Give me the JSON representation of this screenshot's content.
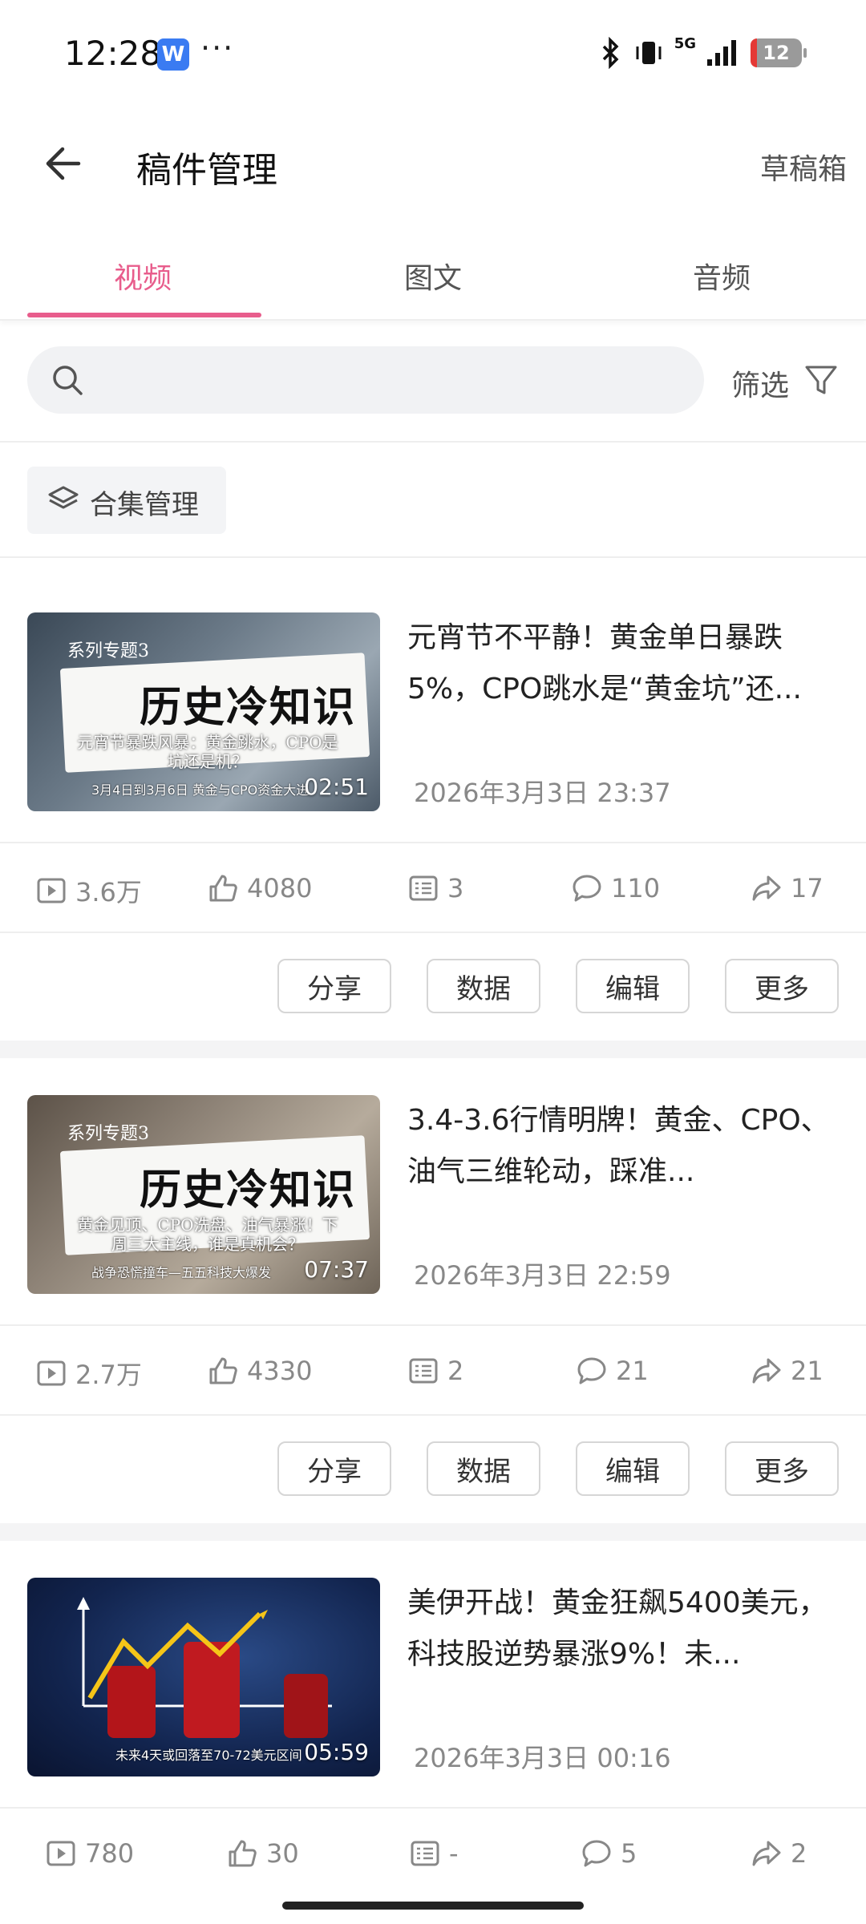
{
  "status_bar": {
    "time": "12:28",
    "app_badge": "W",
    "more": "···",
    "network": "5G",
    "battery": "12"
  },
  "header": {
    "title": "稿件管理",
    "drafts": "草稿箱"
  },
  "tabs": [
    {
      "label": "视频",
      "active": true
    },
    {
      "label": "图文",
      "active": false
    },
    {
      "label": "音频",
      "active": false
    }
  ],
  "search": {
    "placeholder": "",
    "filter_label": "筛选"
  },
  "collection_button": "合集管理",
  "actions": {
    "share": "分享",
    "data": "数据",
    "edit": "编辑",
    "more": "更多"
  },
  "videos": [
    {
      "title": "元宵节不平静！黄金单日暴跌5%，CPO跳水是“黄金坑”还...",
      "date": "2026年3月3日 23:37",
      "duration": "02:51",
      "thumb_badge": "系列专题3",
      "thumb_headline": "历史冷知识",
      "thumb_sub": "元宵节暴跌风暴：黄金跳水，CPO是坑还是机？",
      "thumb_foot": "3月4日到3月6日 黄金与CPO资金大进",
      "views": "3.6万",
      "likes": "4080",
      "danmaku": "3",
      "comments": "110",
      "shares": "17"
    },
    {
      "title": "3.4-3.6行情明牌！黄金、CPO、油气三维轮动，踩准...",
      "date": "2026年3月3日 22:59",
      "duration": "07:37",
      "thumb_badge": "系列专题3",
      "thumb_headline": "历史冷知识",
      "thumb_sub": "黄金见顶、CPO洗盘、油气暴涨！下周三大主线，谁是真机会？",
      "thumb_foot": "战争恐慌撞车—五五科技大爆发",
      "views": "2.7万",
      "likes": "4330",
      "danmaku": "2",
      "comments": "21",
      "shares": "21"
    },
    {
      "title": "美伊开战！黄金狂飙5400美元，科技股逆势暴涨9%！未...",
      "date": "2026年3月3日 00:16",
      "duration": "05:59",
      "thumb_foot": "未来4天或回落至70-72美元区间",
      "views": "780",
      "likes": "30",
      "danmaku": "-",
      "comments": "5",
      "shares": "2"
    }
  ],
  "colors": {
    "accent": "#e85d8c",
    "muted_text": "#888888"
  }
}
